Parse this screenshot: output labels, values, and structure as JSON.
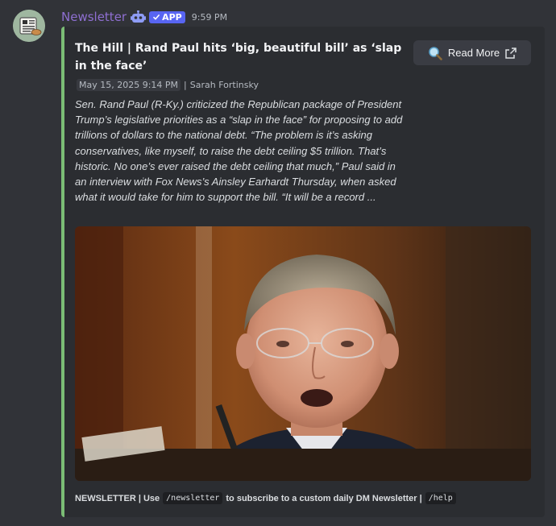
{
  "message": {
    "username": "Newsletter",
    "app_badge": "APP",
    "timestamp": "9:59 PM"
  },
  "embed": {
    "accent_color": "#7bbd75",
    "title": "The Hill | Rand Paul hits ‘big, beautiful bill’ as ‘slap in the face’",
    "date": "May 15, 2025 9:14 PM",
    "author": "Sarah Fortinsky",
    "description": "Sen. Rand Paul (R-Ky.) criticized the Republican package of President Trump’s legislative priorities as a “slap in the face” for proposing to add trillions of dollars to the national debt. “The problem is it’s asking conservatives, like myself, to raise the debt ceiling $5 trillion. That’s historic. No one’s ever raised the debt ceiling that much,” Paul said in an interview with Fox News’s Ainsley Earhardt Thursday, when asked what it would take for him to support the bill. “It will be a record ...",
    "read_more_label": "Read More",
    "footer": {
      "prefix": "NEWSLETTER | Use",
      "command1": "/newsletter",
      "middle": "to subscribe to a custom daily DM Newsletter |",
      "command2": "/help"
    }
  },
  "icons": {
    "bot": "robot-icon",
    "verified": "check-icon",
    "search": "magnifier-icon",
    "external": "external-link-icon"
  }
}
